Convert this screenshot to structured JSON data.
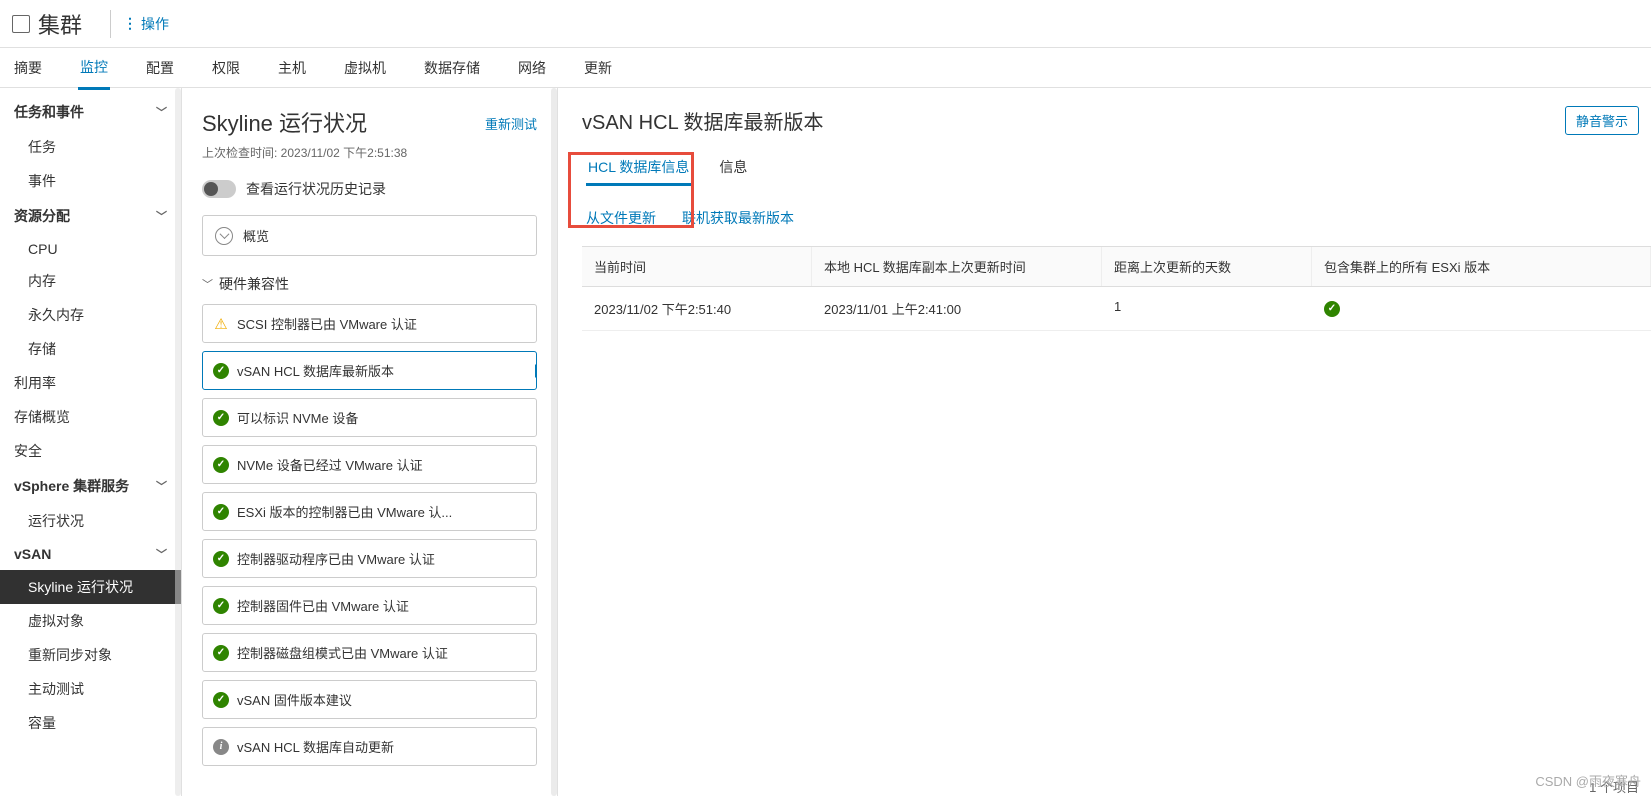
{
  "header": {
    "cluster_title": "集群",
    "actions_label": "操作"
  },
  "main_tabs": [
    "摘要",
    "监控",
    "配置",
    "权限",
    "主机",
    "虚拟机",
    "数据存储",
    "网络",
    "更新"
  ],
  "main_tabs_active_index": 1,
  "sidebar": {
    "sections": [
      {
        "title": "任务和事件",
        "items": [
          "任务",
          "事件"
        ]
      },
      {
        "title": "资源分配",
        "items": [
          "CPU",
          "内存",
          "永久内存",
          "存储"
        ]
      }
    ],
    "flat_items": [
      "利用率",
      "存储概览",
      "安全"
    ],
    "section_services": {
      "title": "vSphere 集群服务",
      "items": [
        "运行状况"
      ]
    },
    "section_vsan": {
      "title": "vSAN",
      "items": [
        "Skyline 运行状况",
        "虚拟对象",
        "重新同步对象",
        "主动测试",
        "容量"
      ],
      "active_index": 0
    }
  },
  "mid_panel": {
    "title": "Skyline 运行状况",
    "last_check_label": "上次检查时间: 2023/11/02 下午2:51:38",
    "retest_label": "重新测试",
    "history_label": "查看运行状况历史记录",
    "overview_label": "概览",
    "group_label": "硬件兼容性",
    "health_items": [
      {
        "status": "warn",
        "text": "SCSI 控制器已由 VMware 认证"
      },
      {
        "status": "ok",
        "text": "vSAN HCL 数据库最新版本",
        "selected": true
      },
      {
        "status": "ok",
        "text": "可以标识 NVMe 设备"
      },
      {
        "status": "ok",
        "text": "NVMe 设备已经过 VMware 认证"
      },
      {
        "status": "ok",
        "text": "ESXi 版本的控制器已由 VMware 认..."
      },
      {
        "status": "ok",
        "text": "控制器驱动程序已由 VMware 认证"
      },
      {
        "status": "ok",
        "text": "控制器固件已由 VMware 认证"
      },
      {
        "status": "ok",
        "text": "控制器磁盘组模式已由 VMware 认证"
      },
      {
        "status": "ok",
        "text": "vSAN 固件版本建议"
      },
      {
        "status": "info",
        "text": "vSAN HCL 数据库自动更新"
      }
    ]
  },
  "right_panel": {
    "title": "vSAN HCL 数据库最新版本",
    "silence_label": "静音警示",
    "subtabs": [
      "HCL 数据库信息",
      "信息"
    ],
    "subtabs_active_index": 0,
    "actions": {
      "update_from_file": "从文件更新",
      "get_latest_online": "联机获取最新版本"
    },
    "table": {
      "headers": [
        "当前时间",
        "本地 HCL 数据库副本上次更新时间",
        "距离上次更新的天数",
        "包含集群上的所有 ESXi 版本"
      ],
      "row": {
        "current_time": "2023/11/02 下午2:51:40",
        "last_update": "2023/11/01 上午2:41:00",
        "days": "1",
        "includes_all": true
      }
    },
    "item_count_label": "1 个项目"
  },
  "watermark": "CSDN @雨夜寒舟"
}
